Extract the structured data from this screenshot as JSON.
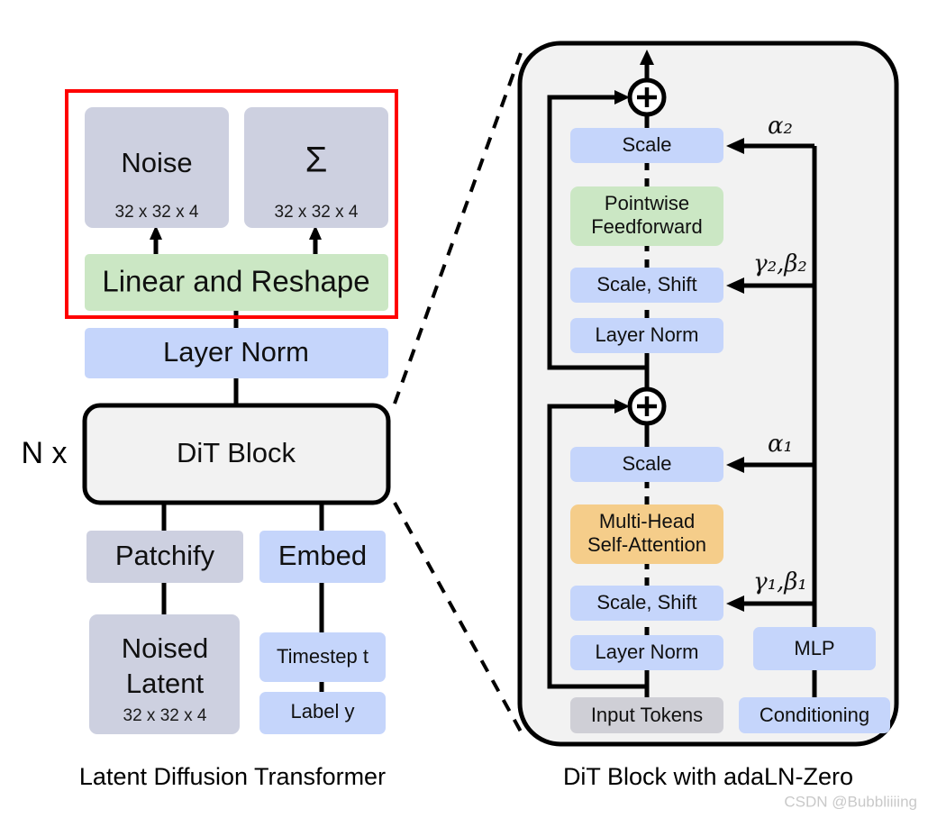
{
  "figure": {
    "title_left": "Latent Diffusion Transformer",
    "title_right": "DiT Block with adaLN-Zero",
    "watermark": "CSDN @Bubbliiiing"
  },
  "colors": {
    "gray_block": "#cdd0e0",
    "blue_block": "#c5d5fb",
    "green_block": "#cbe7c4",
    "orange_block": "#f5cd8a",
    "panel_bg": "#f2f2f2",
    "panel_border": "#000000",
    "highlight_red": "#ff0000",
    "dit_block_bg": "#f2f2f2",
    "input_tokens_gray": "#cfcfd6",
    "watermark_gray": "#c9c9c9",
    "text": "#101010"
  },
  "left_panel": {
    "repeat_label": "N x",
    "highlight_box_name": "output-head-highlight",
    "blocks": {
      "noise": {
        "label": "Noise",
        "dims": "32 x 32 x 4"
      },
      "sigma": {
        "label": "Σ",
        "dims": "32 x 32 x 4"
      },
      "linear_reshape": {
        "label": "Linear and Reshape"
      },
      "layer_norm": {
        "label": "Layer Norm"
      },
      "dit_block": {
        "label": "DiT Block"
      },
      "patchify": {
        "label": "Patchify"
      },
      "embed": {
        "label": "Embed"
      },
      "noised_latent": {
        "label_line1": "Noised",
        "label_line2": "Latent",
        "dims": "32 x 32 x 4"
      },
      "timestep": {
        "label": "Timestep t"
      },
      "label_y": {
        "label": "Label y"
      }
    }
  },
  "right_panel": {
    "blocks": {
      "scale_top": {
        "label": "Scale"
      },
      "pointwise_feedforward": {
        "label_line1": "Pointwise",
        "label_line2": "Feedforward"
      },
      "scale_shift_top": {
        "label": "Scale, Shift"
      },
      "layer_norm_top": {
        "label": "Layer Norm"
      },
      "scale_bottom": {
        "label": "Scale"
      },
      "multi_head_self_attention": {
        "label_line1": "Multi-Head",
        "label_line2": "Self-Attention"
      },
      "scale_shift_bottom": {
        "label": "Scale, Shift"
      },
      "layer_norm_bottom": {
        "label": "Layer Norm"
      },
      "input_tokens": {
        "label": "Input Tokens"
      },
      "mlp": {
        "label": "MLP"
      },
      "conditioning": {
        "label": "Conditioning"
      }
    },
    "parameters": {
      "alpha2": "α₂",
      "gamma_beta2": "γ₂,β₂",
      "alpha1": "α₁",
      "gamma_beta1": "γ₁,β₁"
    },
    "operators": {
      "residual_add_top": "+",
      "residual_add_bottom": "+"
    }
  }
}
